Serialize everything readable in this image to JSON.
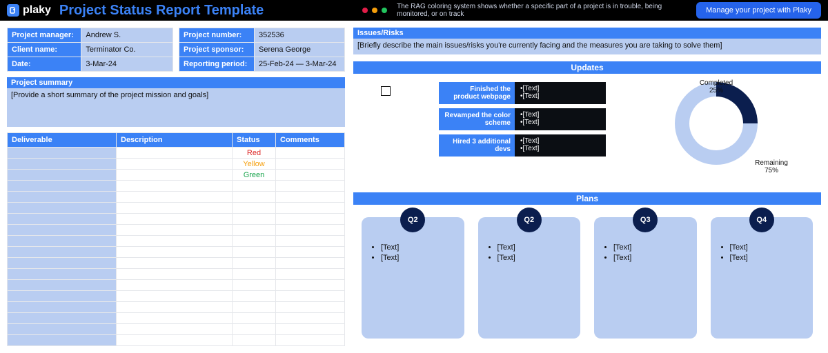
{
  "header": {
    "brand": "plaky",
    "title": "Project Status Report Template",
    "tagline": "The RAG coloring system shows whether a specific part of a project is in trouble, being monitored, or on track",
    "cta": "Manage your project with Plaky",
    "dots": [
      "#e11d48",
      "#f59e0b",
      "#22c55e"
    ]
  },
  "meta_left": [
    {
      "k": "Project manager:",
      "v": "Andrew S."
    },
    {
      "k": "Client name:",
      "v": "Terminator Co."
    },
    {
      "k": "Date:",
      "v": "3-Mar-24"
    }
  ],
  "meta_right": [
    {
      "k": "Project number:",
      "v": "352536"
    },
    {
      "k": "Project sponsor:",
      "v": "Serena George"
    },
    {
      "k": "Reporting period:",
      "v": "25-Feb-24 — 3-Mar-24"
    }
  ],
  "summary": {
    "title": "Project summary",
    "body": "[Provide a short summary of the project mission and goals]"
  },
  "issues": {
    "title": "Issues/Risks",
    "body": "[Briefly describe the main issues/risks you're currently facing and the measures you are taking to solve them]"
  },
  "deliv": {
    "headers": [
      "Deliverable",
      "Description",
      "Status",
      "Comments"
    ],
    "rows": [
      {
        "d": "",
        "e": "",
        "s": "Red",
        "sc": "#dc2626",
        "c": ""
      },
      {
        "d": "",
        "e": "",
        "s": "Yellow",
        "sc": "#f59e0b",
        "c": ""
      },
      {
        "d": "",
        "e": "",
        "s": "Green",
        "sc": "#16a34a",
        "c": ""
      }
    ],
    "empty_rows": 15
  },
  "updates": {
    "title": "Updates",
    "cards": [
      {
        "label": "Finished the product webpage",
        "items": [
          "[Text]",
          "[Text]"
        ]
      },
      {
        "label": "Revamped the color scheme",
        "items": [
          "[Text]",
          "[Text]"
        ]
      },
      {
        "label": "Hired 3 additional devs",
        "items": [
          "[Text]",
          "[Text]"
        ]
      }
    ]
  },
  "chart_data": {
    "type": "pie",
    "title": "",
    "series": [
      {
        "name": "Completed",
        "value": 25,
        "color": "#0b1e4e",
        "label": "Completed\n25%"
      },
      {
        "name": "Remaining",
        "value": 75,
        "color": "#b9cdf1",
        "label": "Remaining\n75%"
      }
    ]
  },
  "plans": {
    "title": "Plans",
    "quarters": [
      {
        "q": "Q2",
        "items": [
          "[Text]",
          "[Text]"
        ]
      },
      {
        "q": "Q2",
        "items": [
          "[Text]",
          "[Text]"
        ]
      },
      {
        "q": "Q3",
        "items": [
          "[Text]",
          "[Text]"
        ]
      },
      {
        "q": "Q4",
        "items": [
          "[Text]",
          "[Text]"
        ]
      }
    ]
  }
}
